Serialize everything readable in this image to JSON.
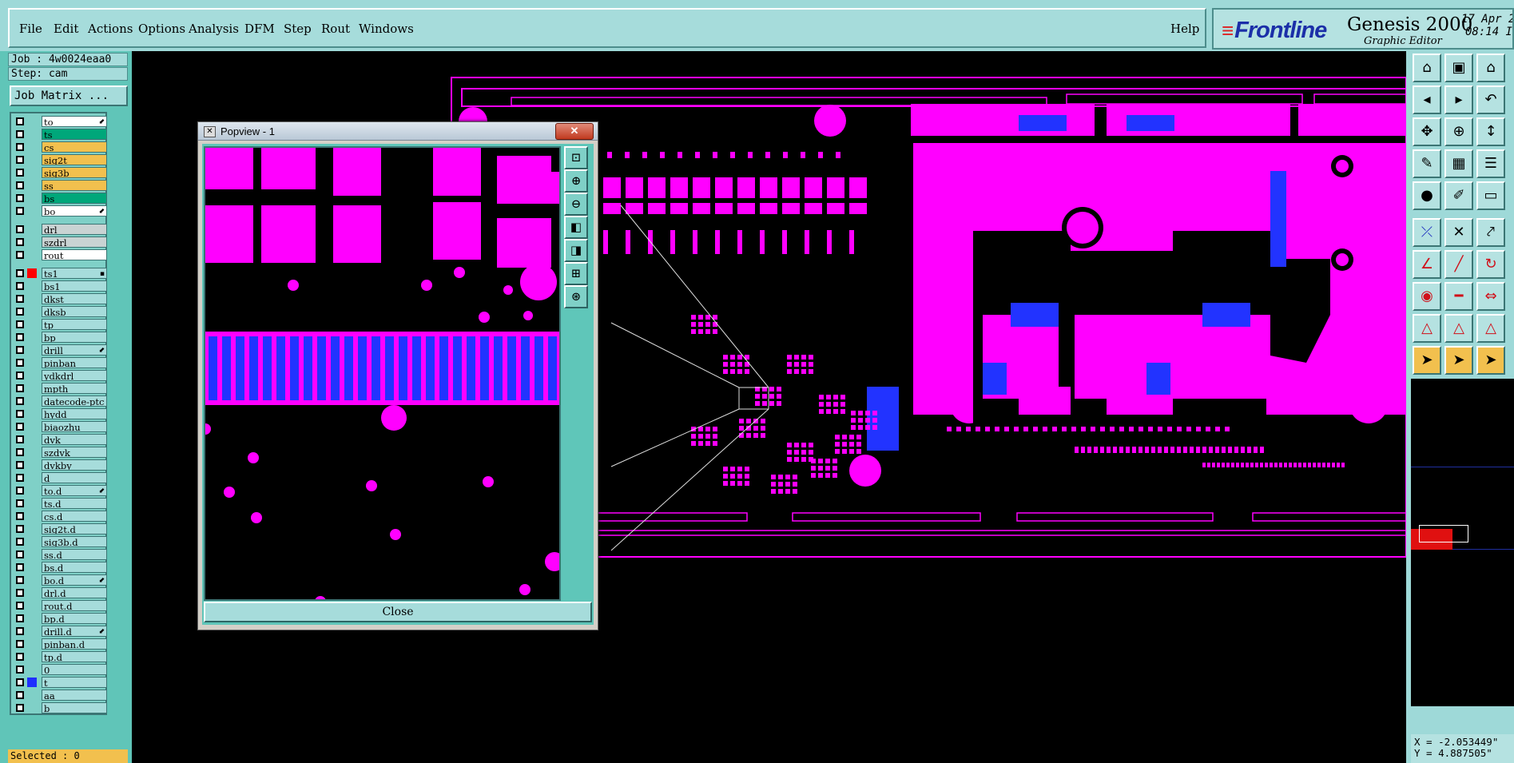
{
  "menu": {
    "items": [
      "File",
      "Edit",
      "Actions",
      "Options",
      "Analysis",
      "DFM",
      "Step",
      "Rout",
      "Windows"
    ],
    "help": "Help"
  },
  "branding": {
    "logo": "Frontline",
    "app_name": "Genesis 2000",
    "subtitle": "Graphic Editor",
    "date_line1": "17 Apr 2",
    "date_line2": "08:14 I"
  },
  "job": {
    "job_label": "Job : 4w0024eaa0",
    "step_label": "Step: cam",
    "matrix_button": "Job Matrix ..."
  },
  "colors": {
    "board_layer": "#ff00ff",
    "highlight": "#1f2fff",
    "signal": "#00a77a",
    "mixed": "#f2c04e",
    "drill": "#d9d9d9",
    "work_layer": "#ff0000"
  },
  "layers": [
    {
      "name": "to",
      "color": "#ffffff",
      "mark": "⬋"
    },
    {
      "name": "ts",
      "color": "#00a77a",
      "mark": ""
    },
    {
      "name": "cs",
      "color": "#f2c04e",
      "mark": ""
    },
    {
      "name": "sig2t",
      "color": "#f2c04e",
      "mark": ""
    },
    {
      "name": "sig3b",
      "color": "#f2c04e",
      "mark": ""
    },
    {
      "name": "ss",
      "color": "#f2c04e",
      "mark": ""
    },
    {
      "name": "bs",
      "color": "#00a77a",
      "mark": ""
    },
    {
      "name": "bo",
      "color": "#ffffff",
      "mark": "⬋"
    },
    {
      "name": "drl",
      "color": "#c9d3d3",
      "mark": ""
    },
    {
      "name": "szdrl",
      "color": "#c9d3d3",
      "mark": ""
    },
    {
      "name": "rout",
      "color": "#ffffff",
      "mark": ""
    },
    {
      "name": "ts1",
      "color": "#a6dcdb",
      "mark": "▪",
      "swatch": "#ff0000",
      "active": true
    },
    {
      "name": "bs1",
      "color": "#a6dcdb",
      "mark": ""
    },
    {
      "name": "dkst",
      "color": "#a6dcdb",
      "mark": ""
    },
    {
      "name": "dksb",
      "color": "#a6dcdb",
      "mark": ""
    },
    {
      "name": "tp",
      "color": "#a6dcdb",
      "mark": ""
    },
    {
      "name": "bp",
      "color": "#a6dcdb",
      "mark": ""
    },
    {
      "name": "drill",
      "color": "#a6dcdb",
      "mark": "⬋"
    },
    {
      "name": "pinban",
      "color": "#a6dcdb",
      "mark": ""
    },
    {
      "name": "ydkdrl",
      "color": "#a6dcdb",
      "mark": ""
    },
    {
      "name": "mpth",
      "color": "#a6dcdb",
      "mark": ""
    },
    {
      "name": "datecode-ptc",
      "color": "#a6dcdb",
      "mark": ""
    },
    {
      "name": "hydd",
      "color": "#a6dcdb",
      "mark": ""
    },
    {
      "name": "biaozhu",
      "color": "#a6dcdb",
      "mark": ""
    },
    {
      "name": "dvk",
      "color": "#a6dcdb",
      "mark": ""
    },
    {
      "name": "szdvk",
      "color": "#a6dcdb",
      "mark": ""
    },
    {
      "name": "dvkby",
      "color": "#a6dcdb",
      "mark": ""
    },
    {
      "name": "d",
      "color": "#a6dcdb",
      "mark": ""
    },
    {
      "name": "to.d",
      "color": "#a6dcdb",
      "mark": "⬋"
    },
    {
      "name": "ts.d",
      "color": "#a6dcdb",
      "mark": ""
    },
    {
      "name": "cs.d",
      "color": "#a6dcdb",
      "mark": ""
    },
    {
      "name": "sig2t.d",
      "color": "#a6dcdb",
      "mark": ""
    },
    {
      "name": "sig3b.d",
      "color": "#a6dcdb",
      "mark": ""
    },
    {
      "name": "ss.d",
      "color": "#a6dcdb",
      "mark": ""
    },
    {
      "name": "bs.d",
      "color": "#a6dcdb",
      "mark": ""
    },
    {
      "name": "bo.d",
      "color": "#a6dcdb",
      "mark": "⬋"
    },
    {
      "name": "drl.d",
      "color": "#a6dcdb",
      "mark": ""
    },
    {
      "name": "rout.d",
      "color": "#a6dcdb",
      "mark": ""
    },
    {
      "name": "bp.d",
      "color": "#a6dcdb",
      "mark": ""
    },
    {
      "name": "drill.d",
      "color": "#a6dcdb",
      "mark": "⬋"
    },
    {
      "name": "pinban.d",
      "color": "#a6dcdb",
      "mark": ""
    },
    {
      "name": "tp.d",
      "color": "#a6dcdb",
      "mark": ""
    },
    {
      "name": "0",
      "color": "#a6dcdb",
      "mark": ""
    },
    {
      "name": "t",
      "color": "#a6dcdb",
      "mark": "",
      "swatch": "#1f2fff"
    },
    {
      "name": "aa",
      "color": "#a6dcdb",
      "mark": ""
    },
    {
      "name": "b",
      "color": "#a6dcdb",
      "mark": ""
    }
  ],
  "status": {
    "selected": "Selected : 0",
    "x": "X = -2.053449\"",
    "y": "Y = 4.887505\""
  },
  "popview": {
    "title": "Popview - 1",
    "close_label": "Close",
    "tools": [
      "zoom-fit-icon",
      "zoom-in-icon",
      "zoom-out-icon",
      "pan-left-icon",
      "pan-right-icon",
      "zoom-area-icon",
      "center-icon"
    ]
  },
  "right_toolbar": [
    "home-icon",
    "save-icon",
    "house-icon",
    "left-arrow-icon",
    "right-arrow-icon",
    "undo-icon",
    "fit-icon",
    "zoom-icon",
    "scale-icon",
    "measure-icon",
    "grid-icon",
    "layers-icon",
    "snap-icon",
    "edit-line-icon",
    "ruler-icon",
    "route-icon",
    "cross-icon",
    "link-icon",
    "draw-icon",
    "diag-icon",
    "rotate-icon",
    "node-icon",
    "dash-icon",
    "width-icon",
    "triangle-icon",
    "triangle-alt-icon",
    "triangle-sel-icon",
    "pointer-icon",
    "pointer-sel-icon",
    "pointer-alt-icon"
  ]
}
